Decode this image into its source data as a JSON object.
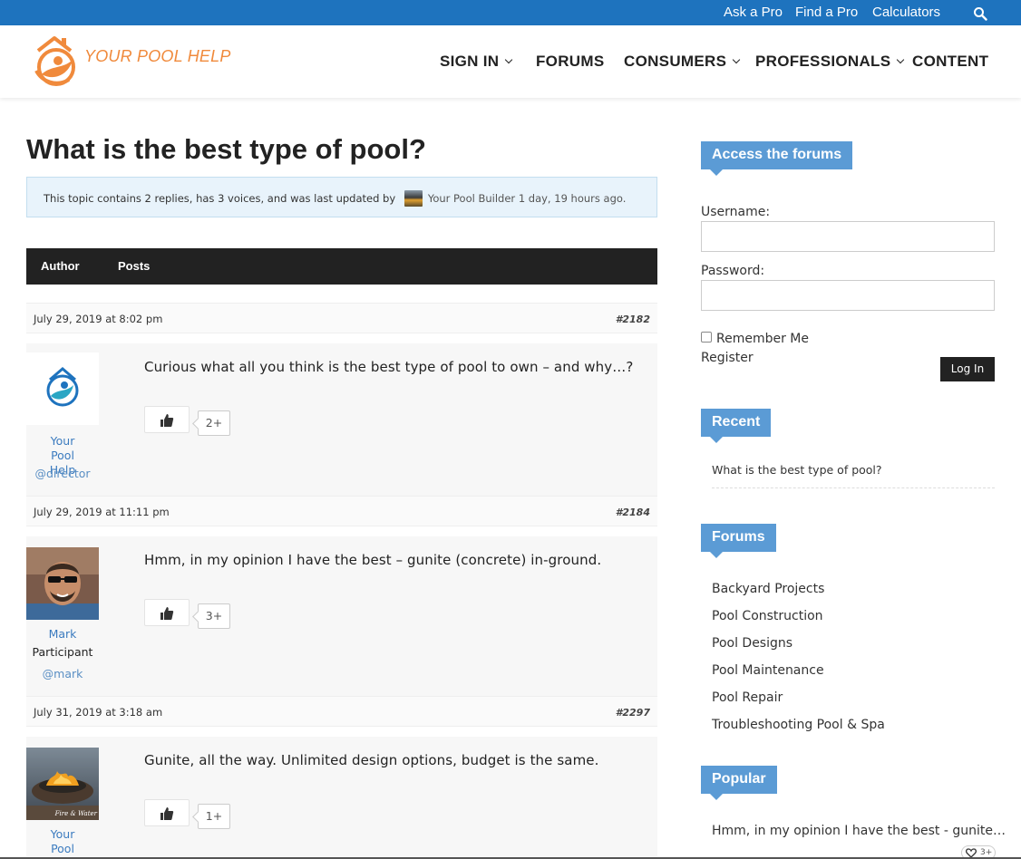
{
  "topbar": {
    "links": [
      "Ask a Pro",
      "Find a Pro",
      "Calculators"
    ],
    "search_icon": "search-icon",
    "color": "#1e73be"
  },
  "header": {
    "logo_text": "YOUR POOL HELP",
    "nav": [
      "SIGN IN",
      "FORUMS",
      "CONSUMERS",
      "PROFESSIONALS",
      "CONTENT"
    ],
    "accent": "#f08a3c"
  },
  "topic": {
    "title": "What is the best type of pool?",
    "info_prefix": "This topic contains 2 replies, has 3 voices, and was last updated by",
    "info_user": "Your Pool Builder",
    "info_suffix": "1 day, 19 hours ago."
  },
  "table_head": {
    "author": "Author",
    "posts": "Posts"
  },
  "posts": [
    {
      "date": "July 29, 2019 at 8:02 pm",
      "id": "#2182",
      "author_name": "Your Pool Help",
      "author_role": "",
      "handle": "@director",
      "text": "Curious what all you think is the best type of pool to own – and why…?",
      "likes": "2+"
    },
    {
      "date": "July 29, 2019 at 11:11 pm",
      "id": "#2184",
      "author_name": "Mark",
      "author_role": "Participant",
      "handle": "@mark",
      "text": "Hmm, in my opinion I have the best – gunite (concrete) in-ground.",
      "likes": "3+"
    },
    {
      "date": "July 31, 2019 at 3:18 am",
      "id": "#2297",
      "author_name": "Your Pool Builder",
      "author_role": "",
      "handle": "",
      "text": "Gunite, all the way. Unlimited design options, budget is the same.",
      "likes": "1+",
      "avatar_caption": "Fire & Water"
    }
  ],
  "sidebar": {
    "access": {
      "title": "Access the forums",
      "username_label": "Username:",
      "password_label": "Password:",
      "remember_label": "Remember Me",
      "register_label": "Register",
      "login_label": "Log In"
    },
    "recent": {
      "title": "Recent",
      "items": [
        "What is the best type of pool?"
      ]
    },
    "forums": {
      "title": "Forums",
      "items": [
        "Backyard Projects",
        "Pool Construction",
        "Pool Designs",
        "Pool Maintenance",
        "Pool Repair",
        "Troubleshooting Pool & Spa"
      ]
    },
    "popular": {
      "title": "Popular",
      "items": [
        "Hmm, in my opinion I have the best - gunite…"
      ],
      "likes": "3+"
    },
    "widget_color": "#5b9bd5"
  }
}
